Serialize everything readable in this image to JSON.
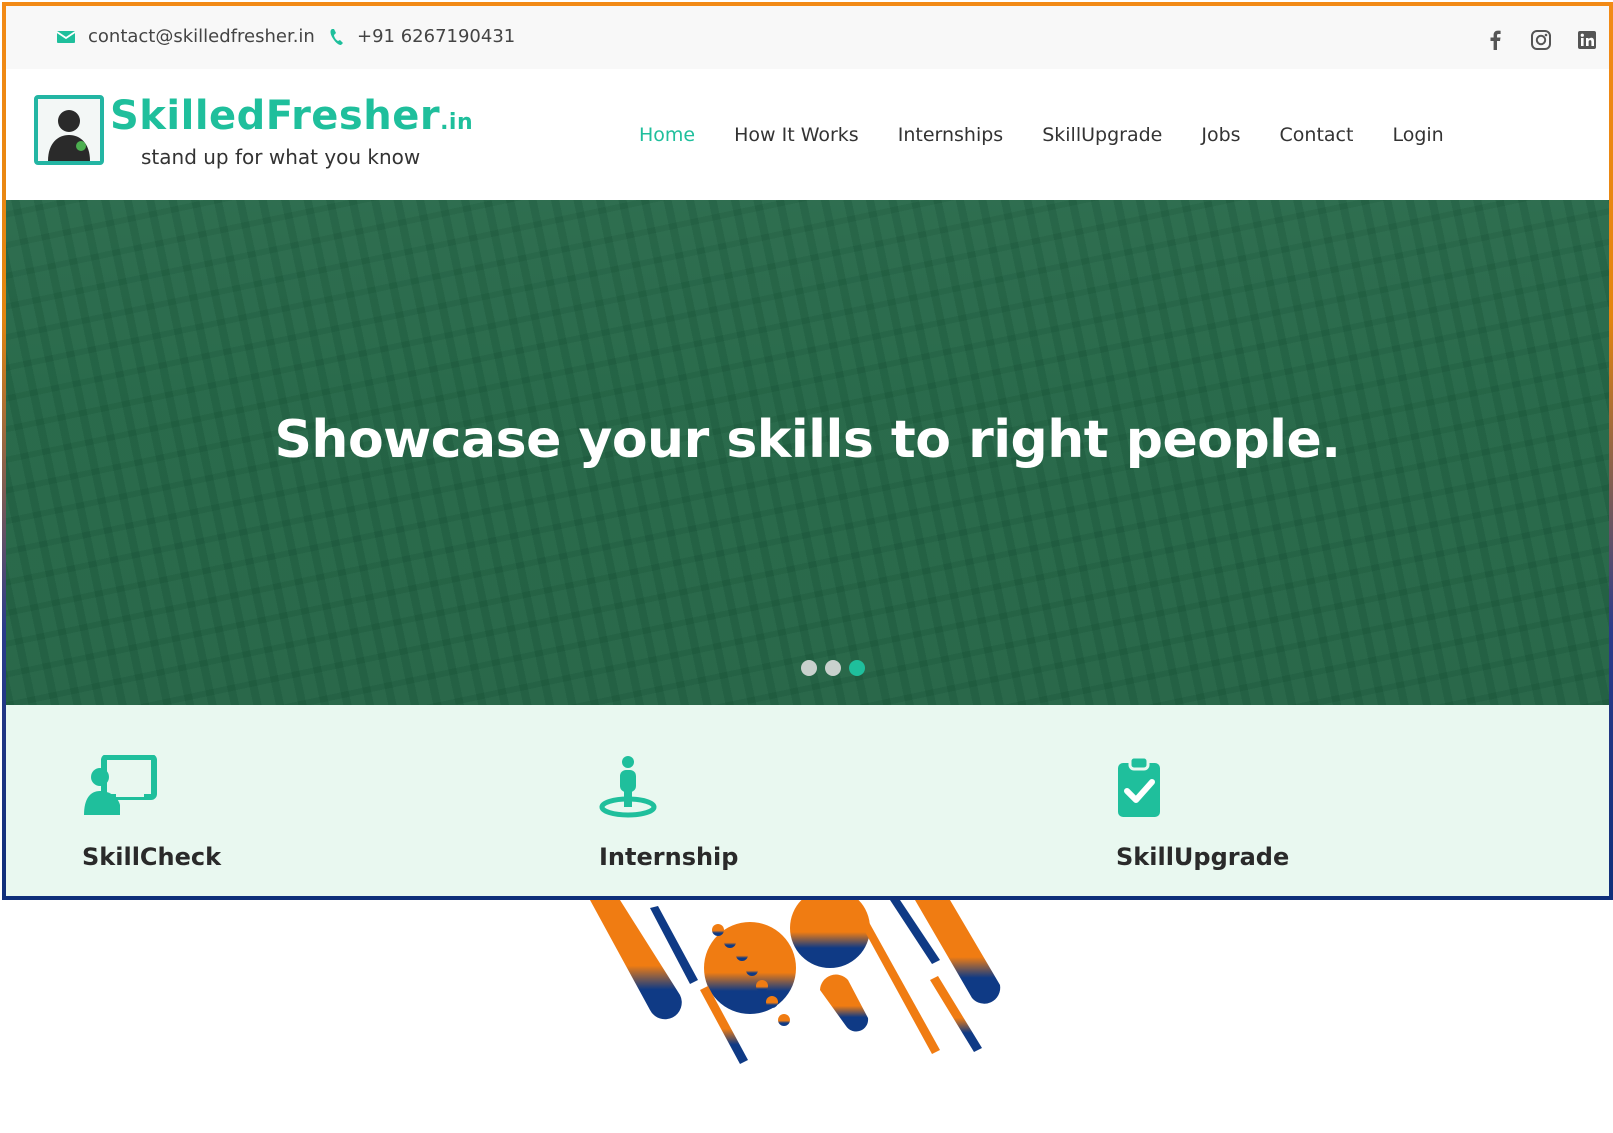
{
  "topbar": {
    "email": "contact@skilledfresher.in",
    "phone": "+91 6267190431",
    "social": [
      "facebook-icon",
      "instagram-icon",
      "linkedin-icon"
    ]
  },
  "brand": {
    "name": "SkilledFresher",
    "tld": ".in",
    "tagline": "stand up for what you know"
  },
  "nav": {
    "items": [
      "Home",
      "How It Works",
      "Internships",
      "SkillUpgrade",
      "Jobs",
      "Contact",
      "Login"
    ],
    "active": "Home"
  },
  "hero": {
    "heading": "Showcase your skills to right people.",
    "slides": 3,
    "active_slide": 3
  },
  "features": [
    {
      "label": "SkillCheck",
      "icon": "presenter-icon"
    },
    {
      "label": "Internship",
      "icon": "person-pin-icon"
    },
    {
      "label": "SkillUpgrade",
      "icon": "clipboard-check-icon"
    }
  ],
  "colors": {
    "brand": "#1fbf9c",
    "frame_orange": "#f28a16",
    "frame_blue": "#0f2f7a"
  }
}
